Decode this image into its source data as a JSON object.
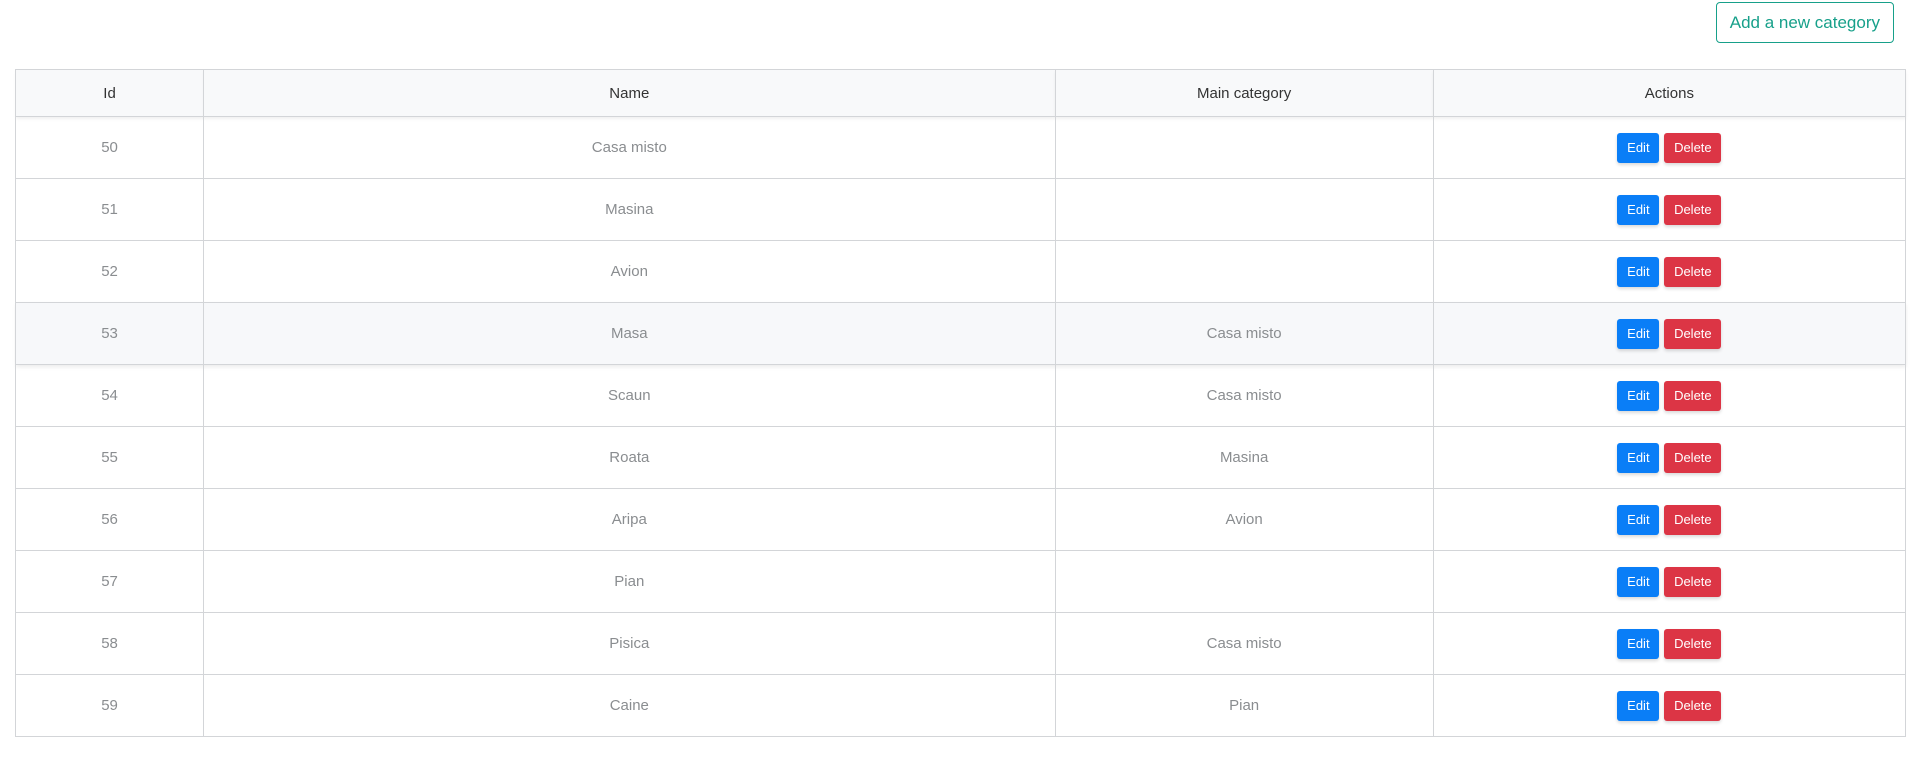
{
  "toolbar": {
    "add_label": "Add a new category"
  },
  "table": {
    "headers": {
      "id": "Id",
      "name": "Name",
      "main_category": "Main category",
      "actions": "Actions"
    },
    "rows": [
      {
        "id": "50",
        "name": "Casa misto",
        "main_category": ""
      },
      {
        "id": "51",
        "name": "Masina",
        "main_category": ""
      },
      {
        "id": "52",
        "name": "Avion",
        "main_category": ""
      },
      {
        "id": "53",
        "name": "Masa",
        "main_category": "Casa misto"
      },
      {
        "id": "54",
        "name": "Scaun",
        "main_category": "Casa misto"
      },
      {
        "id": "55",
        "name": "Roata",
        "main_category": "Masina"
      },
      {
        "id": "56",
        "name": "Aripa",
        "main_category": "Avion"
      },
      {
        "id": "57",
        "name": "Pian",
        "main_category": ""
      },
      {
        "id": "58",
        "name": "Pisica",
        "main_category": "Casa misto"
      },
      {
        "id": "59",
        "name": "Caine",
        "main_category": "Pian"
      }
    ],
    "edit_label": "Edit",
    "delete_label": "Delete"
  },
  "colors": {
    "accent": "#17a08a",
    "edit": "#0a7ef7",
    "delete": "#dc3545"
  }
}
